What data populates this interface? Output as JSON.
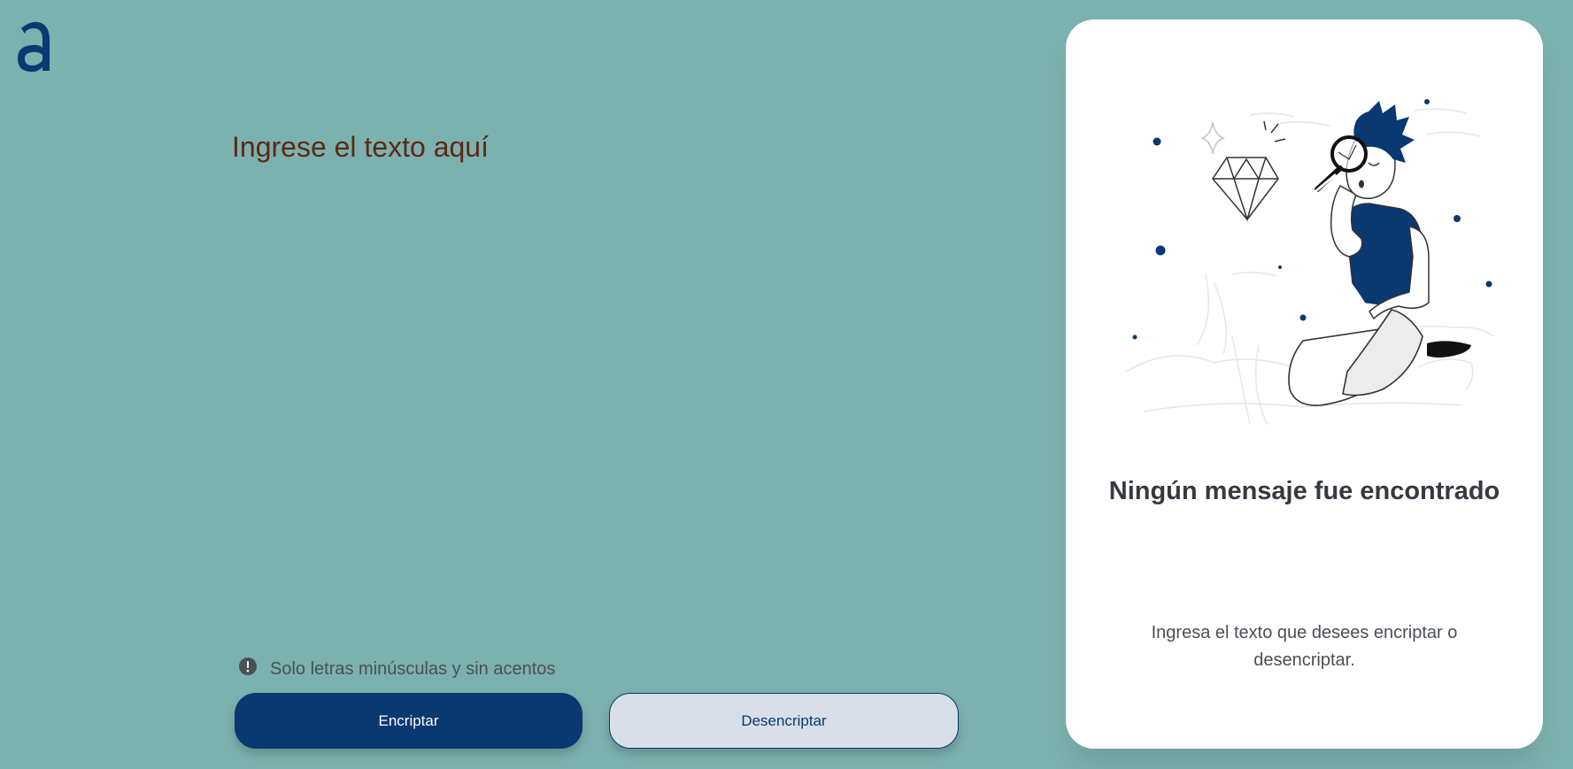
{
  "app": {
    "logo_icon": "alura-a-logo-icon",
    "background_color": "#7bb1ae",
    "accent_color": "#0a3871"
  },
  "input": {
    "placeholder": "Ingrese el texto aquí",
    "value": ""
  },
  "hint": {
    "icon": "exclamation-circle-icon",
    "text": "Solo letras minúsculas y sin acentos"
  },
  "buttons": {
    "encrypt_label": "Encriptar",
    "decrypt_label": "Desencriptar"
  },
  "output_panel": {
    "illustration": "person-with-magnifying-glass-illustration",
    "title": "Ningún mensaje fue encontrado",
    "message": "Ingresa el texto que desees encriptar o desencriptar."
  }
}
